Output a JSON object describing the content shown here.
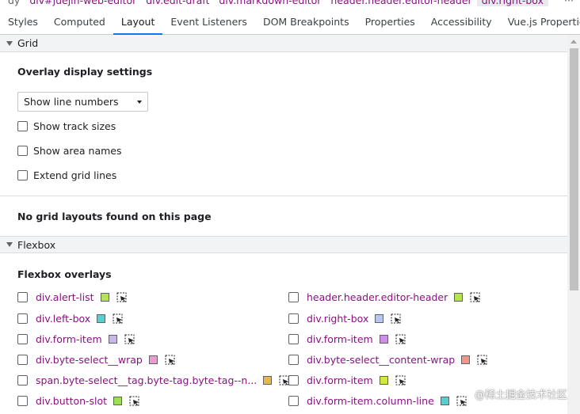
{
  "breadcrumbs": {
    "items": [
      "dy",
      "div#juejin-web-editor",
      "div.edit-draft",
      "div.markdown-editor",
      "header.header.editor-header",
      "div.right-box"
    ],
    "more": "···"
  },
  "tabs": [
    "Styles",
    "Computed",
    "Layout",
    "Event Listeners",
    "DOM Breakpoints",
    "Properties",
    "Accessibility",
    "Vue.js Properties"
  ],
  "grid": {
    "header": "Grid",
    "overlay_title": "Overlay display settings",
    "select_value": "Show line numbers",
    "checkboxes": [
      "Show track sizes",
      "Show area names",
      "Extend grid lines"
    ],
    "empty_message": "No grid layouts found on this page"
  },
  "flexbox": {
    "header": "Flexbox",
    "overlays_title": "Flexbox overlays",
    "items": [
      {
        "name": "div.alert-list",
        "color": "#b5e352"
      },
      {
        "name": "header.header.editor-header",
        "color": "#b5e352"
      },
      {
        "name": "div.left-box",
        "color": "#55d0d0"
      },
      {
        "name": "div.right-box",
        "color": "#b7c7f2"
      },
      {
        "name": "div.form-item",
        "color": "#c8b8e6"
      },
      {
        "name": "div.form-item",
        "color": "#cf8fe8"
      },
      {
        "name": "div.byte-select__wrap",
        "color": "#ec9ad0"
      },
      {
        "name": "div.byte-select__content-wrap",
        "color": "#f2958a"
      },
      {
        "name": "span.byte-select__tag.byte-tag.byte-tag--n...",
        "color": "#e8b64a"
      },
      {
        "name": "div.form-item",
        "color": "#d2e83c"
      },
      {
        "name": "div.button-slot",
        "color": "#9be052"
      },
      {
        "name": "div.form-item.column-line",
        "color": "#55d0d0"
      }
    ]
  },
  "watermark": "@稀土掘金技术社区"
}
